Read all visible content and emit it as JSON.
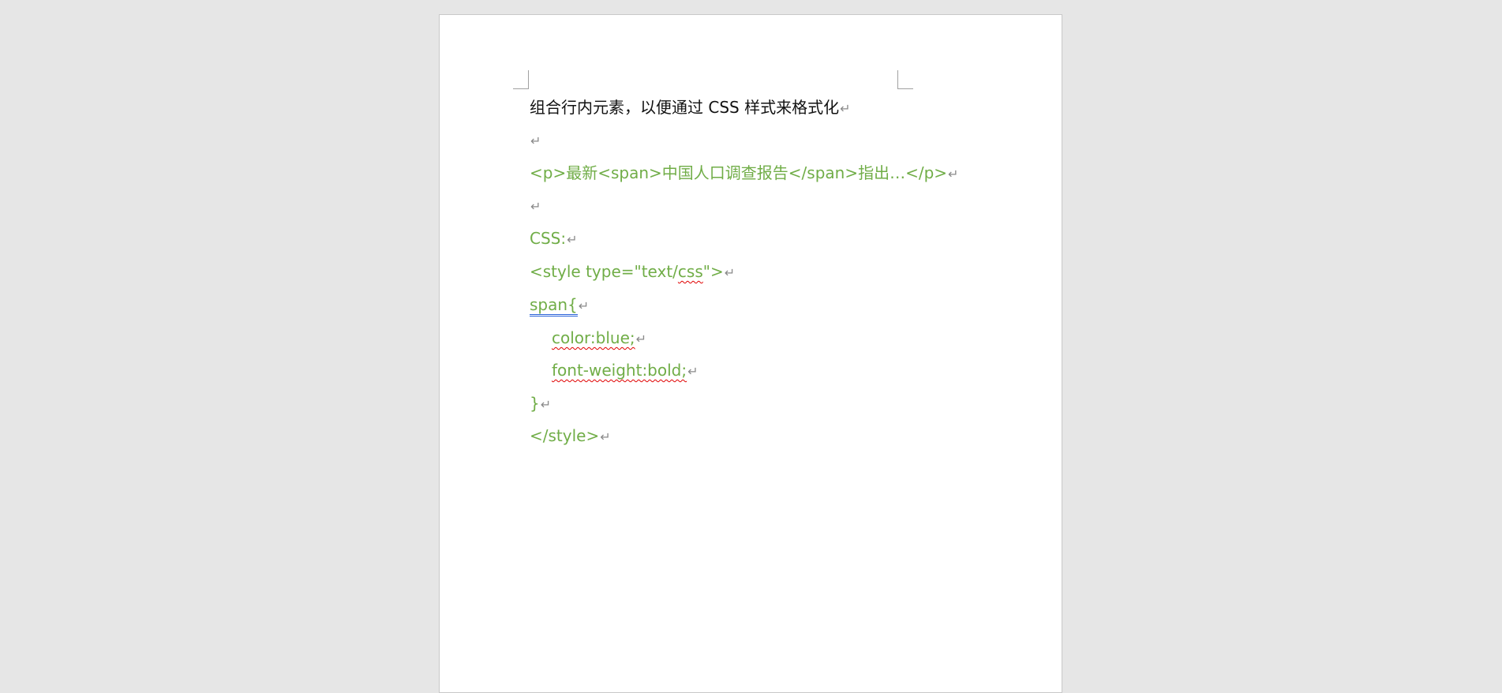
{
  "document": {
    "lines": [
      "组合行内元素，以便通过 CSS 样式来格式化",
      "",
      "<p>最新<span>中国人口调查报告</span>指出…</p>",
      "",
      "CSS:",
      "<style type=\"text/css\">",
      "span{",
      "color:blue;",
      "font-weight:bold;",
      "}",
      "</style>"
    ],
    "style_line_parts": [
      "<style type=\"text/",
      "css",
      "\">"
    ],
    "paragraph_mark": "↵",
    "code_color": "#70ad47"
  }
}
